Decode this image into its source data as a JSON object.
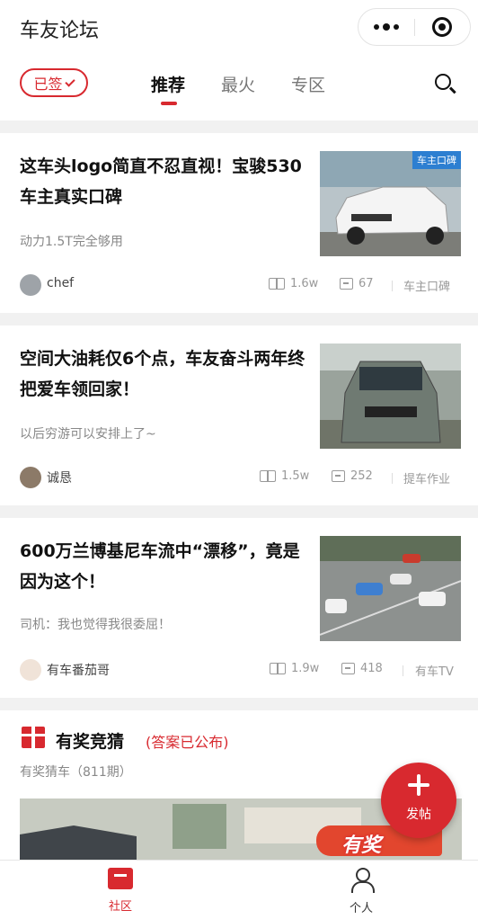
{
  "app": {
    "title": "车友论坛"
  },
  "nav": {
    "signed_label": "已签",
    "tabs": [
      {
        "label": "推荐",
        "active": true
      },
      {
        "label": "最火",
        "active": false
      },
      {
        "label": "专区",
        "active": false
      }
    ]
  },
  "posts": [
    {
      "title": "这车头logo简直不忍直视！宝骏530车主真实口碑",
      "subtitle": "动力1.5T完全够用",
      "author": "chef",
      "views": "1.6w",
      "comments": "67",
      "category": "车主口碑",
      "image_tag": "车主口碑"
    },
    {
      "title": "空间大油耗仅6个点，车友奋斗两年终把爱车领回家！",
      "subtitle": "以后穷游可以安排上了~",
      "author": "诚恳",
      "views": "1.5w",
      "comments": "252",
      "category": "提车作业"
    },
    {
      "title": "600万兰博基尼车流中“漂移”，竟是因为这个！",
      "subtitle": "司机：我也觉得我很委屈！",
      "author": "有车番茄哥",
      "views": "1.9w",
      "comments": "418",
      "category": "有车TV"
    }
  ],
  "quiz": {
    "title": "有奖竞猜",
    "status": "(答案已公布)",
    "subtitle": "有奖猜车（811期）",
    "banner_text": "有奖"
  },
  "fab": {
    "label": "发帖"
  },
  "tabbar": {
    "items": [
      {
        "label": "社区",
        "active": true
      },
      {
        "label": "个人",
        "active": false
      }
    ]
  },
  "colors": {
    "accent": "#d8292f",
    "tag_blue": "#2d7fd1",
    "divider": "#f1f1f1"
  }
}
